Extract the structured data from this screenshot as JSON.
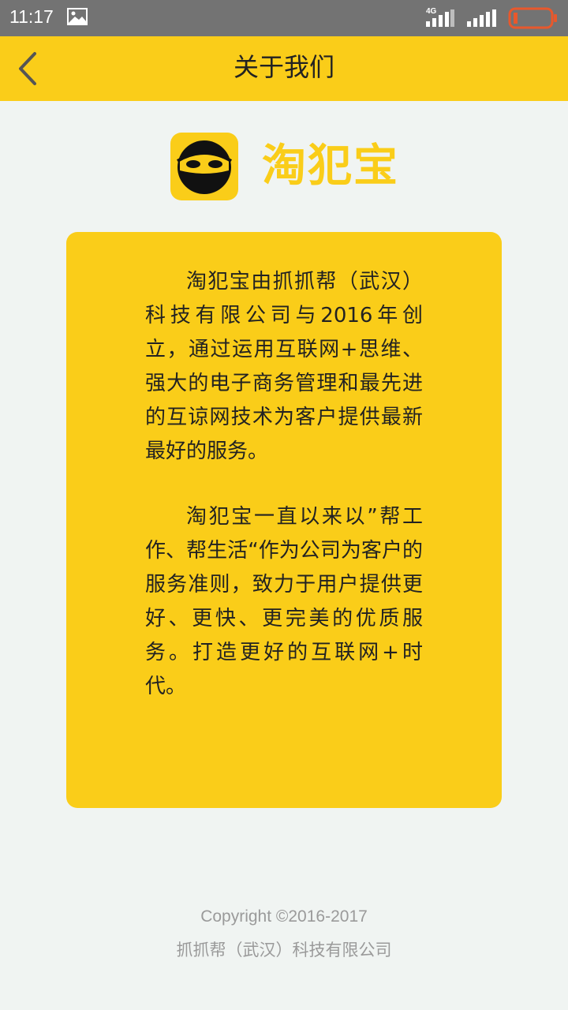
{
  "status_bar": {
    "time": "11:17",
    "network": "4G",
    "icons": [
      "gallery-icon",
      "signal-icon",
      "signal-icon",
      "battery-icon"
    ]
  },
  "nav": {
    "back_icon": "chevron-left-icon",
    "title": "关于我们"
  },
  "app": {
    "icon": "masked-face-icon",
    "name": "淘犯宝"
  },
  "about": {
    "paragraph_1": "淘犯宝由抓抓帮（武汉）科技有限公司与2016年创立，通过运用互联网+思维、强大的电子商务管理和最先进的互谅网技术为客户提供最新最好的服务。",
    "paragraph_2": "淘犯宝一直以来以”帮工作、帮生活“作为公司为客户的服务准则，致力于用户提供更好、更快、更完美的优质服务。打造更好的互联网+时代。"
  },
  "footer": {
    "copyright": "Copyright ©2016-2017",
    "company": "抓抓帮（武汉）科技有限公司"
  },
  "colors": {
    "accent": "#facd19",
    "status_bar": "#737373",
    "background": "#f0f4f2",
    "battery_low": "#e8582c",
    "footer_text": "#9a9a9a"
  }
}
